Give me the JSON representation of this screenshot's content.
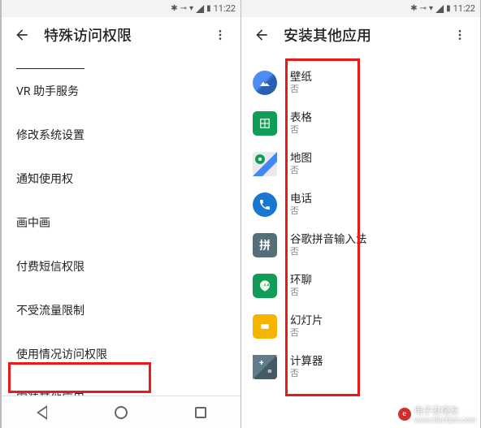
{
  "status": {
    "time": "11:22",
    "bluetooth": "✱",
    "key": "⊸",
    "wifi": "▾",
    "signal": "◢",
    "battery": "▮"
  },
  "left_screen": {
    "header_title": "特殊访问权限",
    "items": [
      "VR 助手服务",
      "修改系统设置",
      "通知使用权",
      "画中画",
      "付费短信权限",
      "不受流量限制",
      "使用情况访问权限",
      "安装其他应用"
    ]
  },
  "right_screen": {
    "header_title": "安装其他应用",
    "apps": [
      {
        "name": "壁纸",
        "status": "否",
        "icon": "wallpaper"
      },
      {
        "name": "表格",
        "status": "否",
        "icon": "sheets"
      },
      {
        "name": "地图",
        "status": "否",
        "icon": "maps"
      },
      {
        "name": "电话",
        "status": "否",
        "icon": "phone"
      },
      {
        "name": "谷歌拼音输入法",
        "status": "否",
        "icon": "pinyin"
      },
      {
        "name": "环聊",
        "status": "否",
        "icon": "hangouts"
      },
      {
        "name": "幻灯片",
        "status": "否",
        "icon": "slides"
      },
      {
        "name": "计算器",
        "status": "否",
        "icon": "calc"
      }
    ]
  },
  "watermark": {
    "text": "电子发烧友",
    "url": "www.elecfans.com"
  }
}
